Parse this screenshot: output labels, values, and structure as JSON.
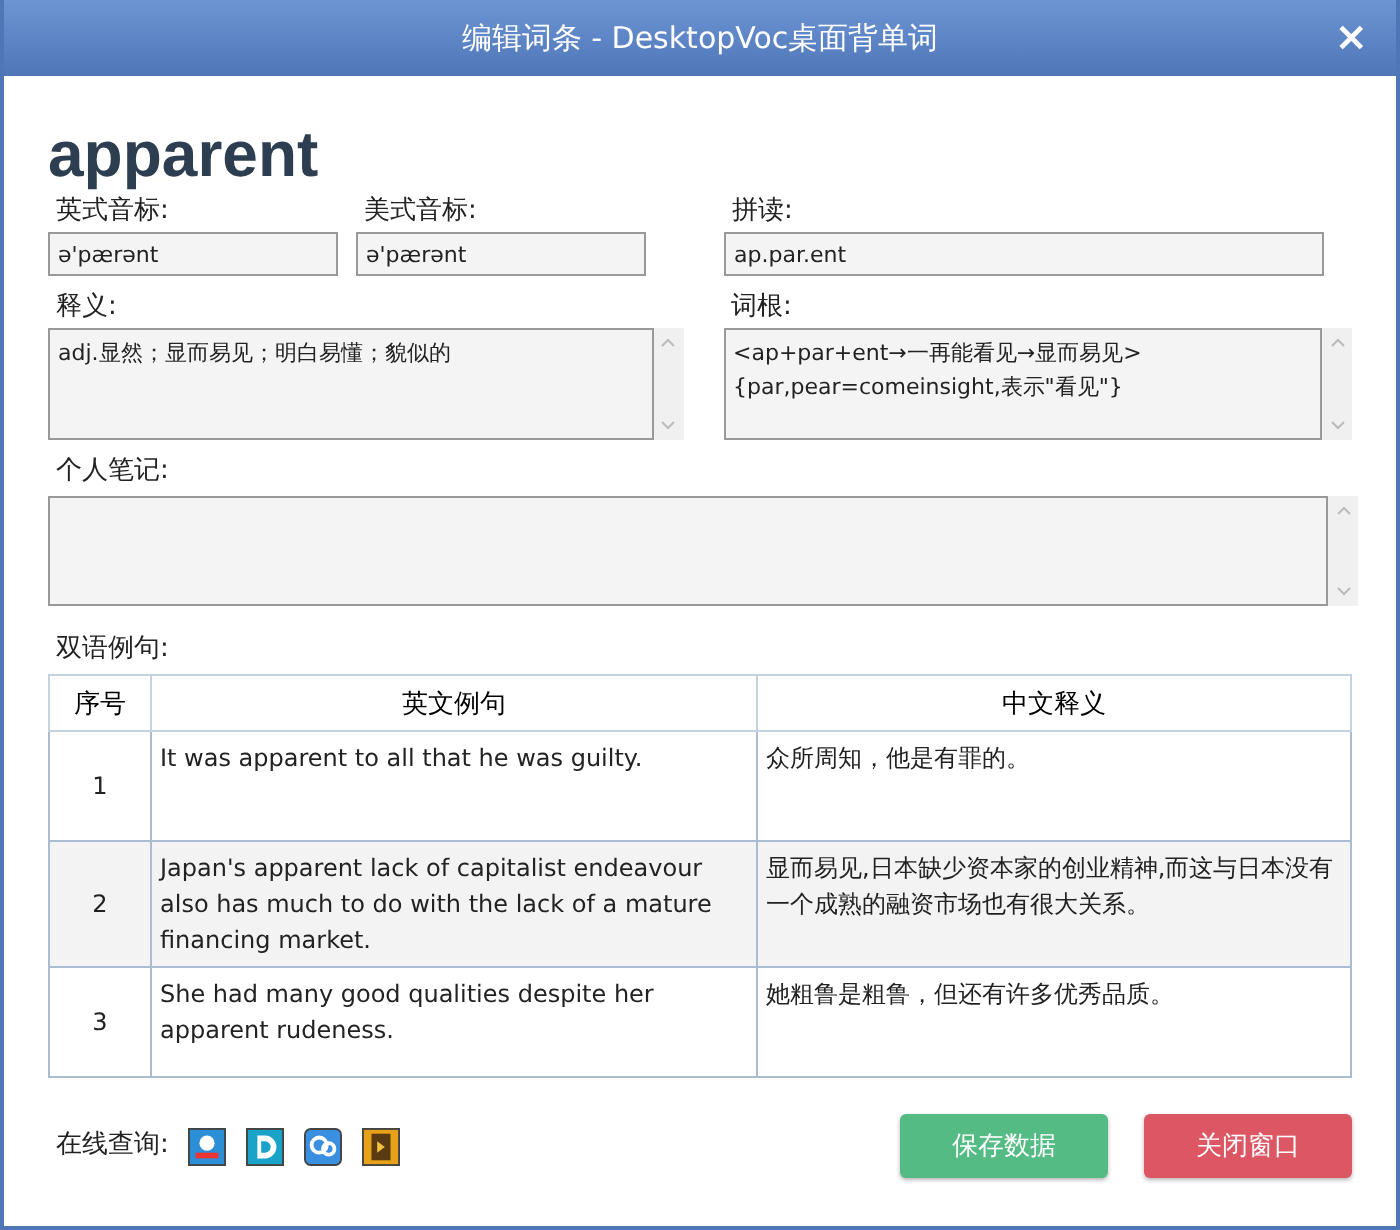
{
  "window": {
    "title": "编辑词条 - DesktopVoc桌面背单词",
    "close": "×"
  },
  "word": "apparent",
  "fields": [
    {
      "label": "英式音标:",
      "value": "ə'pærənt"
    },
    {
      "label": "美式音标:",
      "value": "ə'pærənt"
    },
    {
      "label": "拼读:",
      "value": "ap.par.ent"
    }
  ],
  "meaning": {
    "label": "释义:",
    "value": "adj.显然；显而易见；明白易懂；貌似的"
  },
  "root": {
    "label": "词根:",
    "value": "<ap+par+ent→一再能看见→显而易见>\n{par,pear=comeinsight,表示\"看见\"}"
  },
  "notes": {
    "label": "个人笔记:"
  },
  "examples": {
    "label": "双语例句:",
    "columns": [
      "序号",
      "英文例句",
      "中文释义"
    ],
    "rows": [
      {
        "no": "1",
        "en": "It was apparent to all that he was guilty.",
        "zh": "众所周知，他是有罪的。",
        "selected": false
      },
      {
        "no": "2",
        "en": "Japan's apparent lack of capitalist endeavour also has much to do with the lack of a mature financing market.",
        "zh": "显而易见,日本缺少资本家的创业精神,而这与日本没有一个成熟的融资市场也有很大关系。",
        "selected": true
      },
      {
        "no": "3",
        "en": "She had many good qualities despite her apparent rudeness.",
        "zh": "她粗鲁是粗鲁，但还有许多优秀品质。",
        "selected": false
      }
    ]
  },
  "online": {
    "label": "在线查询:",
    "sources": [
      {
        "kind": "reader"
      },
      {
        "kind": "badge"
      },
      {
        "kind": "logo"
      },
      {
        "kind": "book"
      }
    ]
  },
  "buttons": [
    {
      "label": "保存数据",
      "kind": "save"
    },
    {
      "label": "关闭窗口",
      "kind": "close"
    }
  ]
}
